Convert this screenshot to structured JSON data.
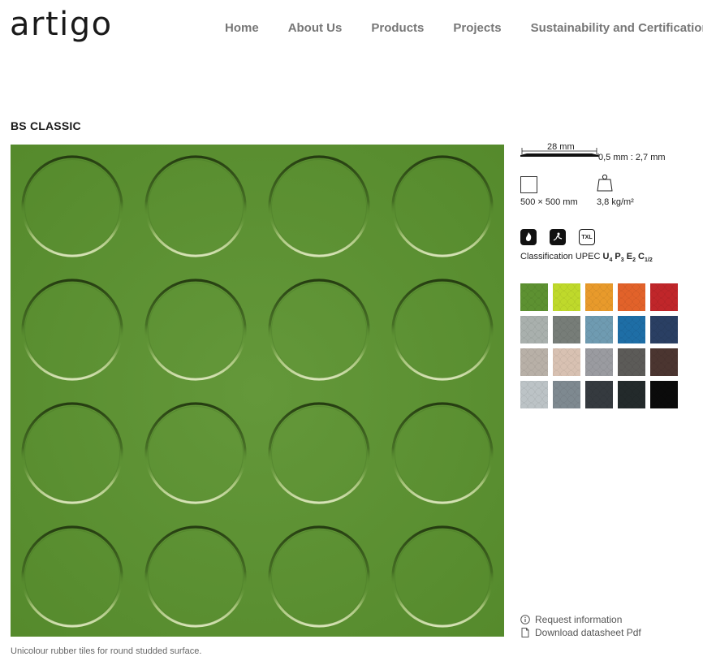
{
  "header": {
    "logo": "artigo",
    "nav": [
      "Home",
      "About Us",
      "Products",
      "Projects",
      "Sustainability and Certifications"
    ]
  },
  "product": {
    "title": "BS CLASSIC",
    "caption": "Unicolour rubber tiles for round studded surface.",
    "tile_color": "#5d9131"
  },
  "specs": {
    "width": "28 mm",
    "thickness": "0,5 mm : 2,7 mm",
    "size": "500 × 500 mm",
    "weight": "3,8 kg/m²",
    "cert_icons": [
      "fire-icon",
      "slip-resistance-icon",
      "TXL"
    ],
    "classification_prefix": "Classification UPEC ",
    "classification_parts": [
      {
        "letter": "U",
        "sub": "4"
      },
      {
        "letter": "P",
        "sub": "3"
      },
      {
        "letter": "E",
        "sub": "2"
      },
      {
        "letter": "C",
        "sub": "1/2"
      }
    ]
  },
  "swatches": [
    "#5d9131",
    "#bfd92b",
    "#e89a2b",
    "#e2622a",
    "#c0262a",
    "#a9b0ad",
    "#777d78",
    "#6f9bb1",
    "#1e6ea6",
    "#2a3f63",
    "#b8b0a7",
    "#d8c1b2",
    "#9a9ba0",
    "#5c5b58",
    "#4b3530",
    "#bcc3c6",
    "#7e8990",
    "#353a3f",
    "#232a2b",
    "#0b0b0b"
  ],
  "links": {
    "request": "Request information",
    "download": "Download datasheet Pdf"
  }
}
